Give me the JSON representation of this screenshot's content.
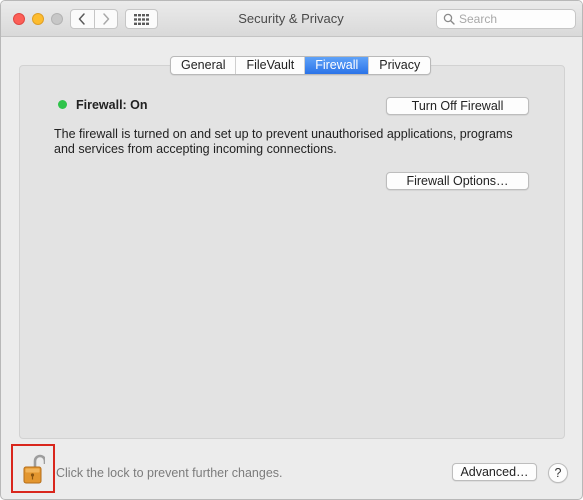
{
  "window": {
    "title": "Security & Privacy",
    "controls": {
      "close_color": "#fc5f57",
      "minimize_color": "#fdbc2e",
      "zoom_color": "#c7c7c7"
    }
  },
  "toolbar": {
    "back_icon": "chevron-left-icon",
    "forward_icon": "chevron-right-icon",
    "show_all_icon": "grid-icon",
    "search": {
      "placeholder": "Search",
      "value": ""
    }
  },
  "tabs": [
    {
      "label": "General",
      "active": false
    },
    {
      "label": "FileVault",
      "active": false
    },
    {
      "label": "Firewall",
      "active": true
    },
    {
      "label": "Privacy",
      "active": false
    }
  ],
  "firewall": {
    "status_label": "Firewall: On",
    "status_color": "#2fc34a",
    "toggle_button_label": "Turn Off Firewall",
    "description": "The firewall is turned on and set up to prevent unauthorised applications, programs and services from accepting incoming connections.",
    "options_button_label": "Firewall Options…"
  },
  "footer": {
    "lock_icon": "unlocked-padlock-icon",
    "lock_message": "Click the lock to prevent further changes.",
    "advanced_button_label": "Advanced…",
    "help_button_label": "?"
  },
  "colors": {
    "accent": "#2a73e8",
    "highlight_border": "#d9261c"
  }
}
